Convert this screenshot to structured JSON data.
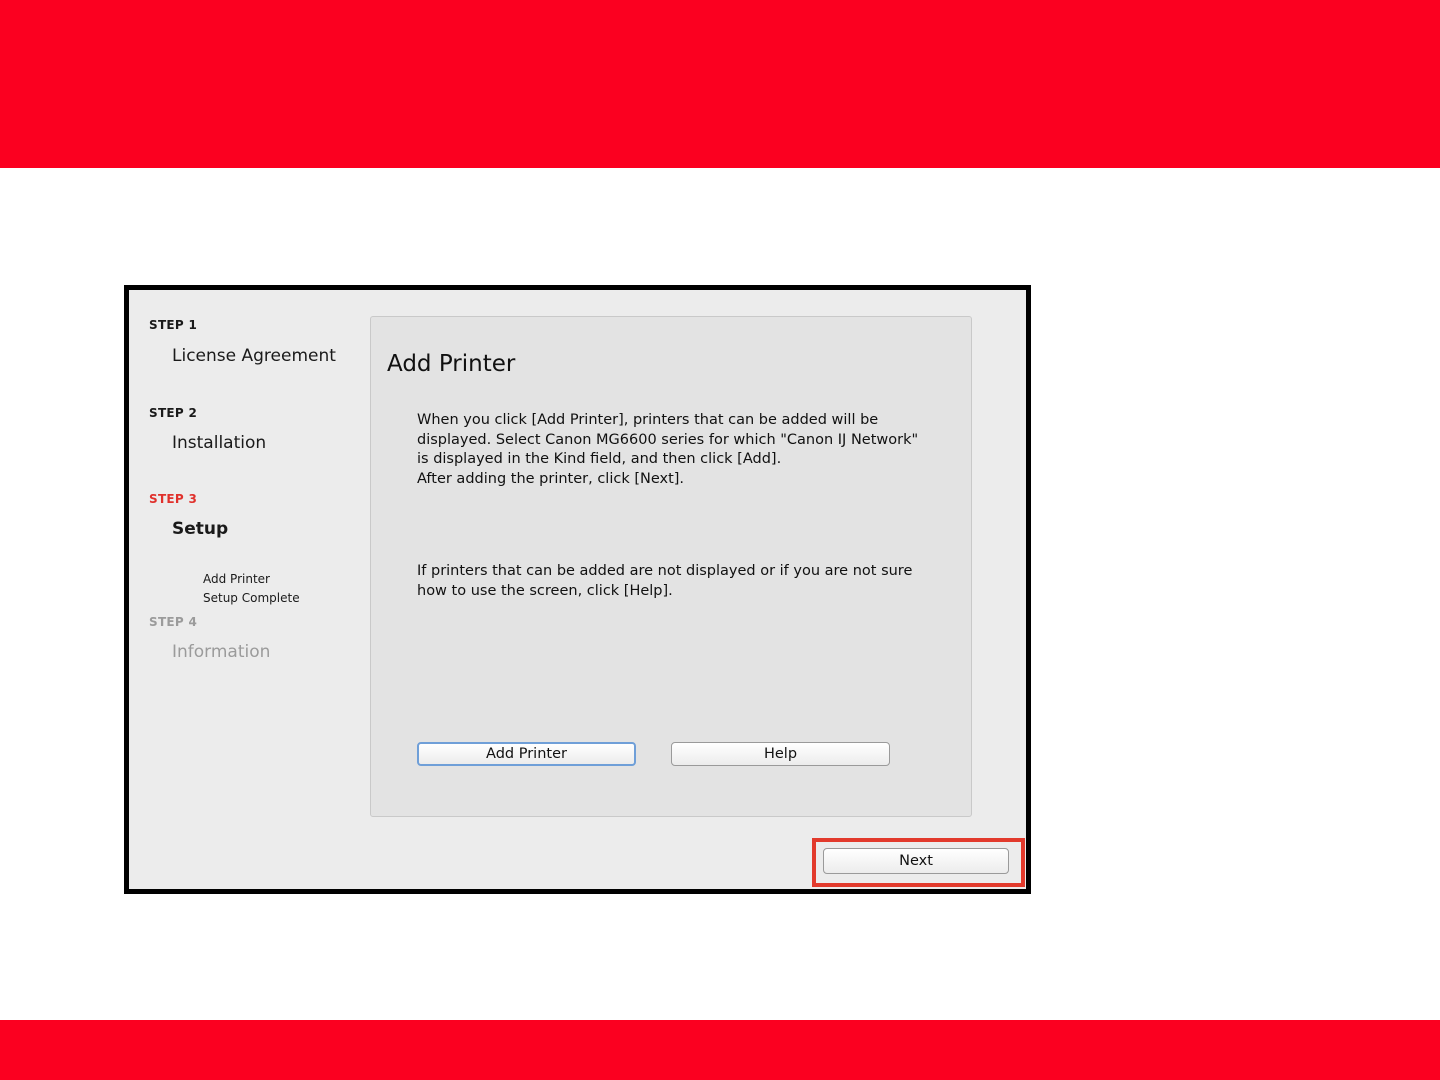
{
  "colors": {
    "brand_red": "#fb0020",
    "highlight": "#e23a2c",
    "active_step": "#e0312c"
  },
  "sidebar": {
    "steps": [
      {
        "label": "STEP 1",
        "title": "License Agreement"
      },
      {
        "label": "STEP 2",
        "title": "Installation"
      },
      {
        "label": "STEP 3",
        "title": "Setup",
        "state": "active",
        "sub_items": [
          "Add Printer",
          "Setup Complete"
        ]
      },
      {
        "label": "STEP 4",
        "title": "Information",
        "state": "disabled"
      }
    ]
  },
  "panel": {
    "title": "Add Printer",
    "paragraph1": [
      "When you click [Add Printer], printers that can be added will be",
      "displayed. Select Canon MG6600 series for which \"Canon IJ Network\"",
      "is displayed in the Kind field, and then click [Add].",
      "After adding the printer, click [Next]."
    ],
    "paragraph2": [
      "If printers that can be added are not displayed or if you are not sure",
      "how to use the screen, click [Help]."
    ],
    "add_printer_label": "Add Printer",
    "help_label": "Help"
  },
  "footer": {
    "next_label": "Next"
  }
}
